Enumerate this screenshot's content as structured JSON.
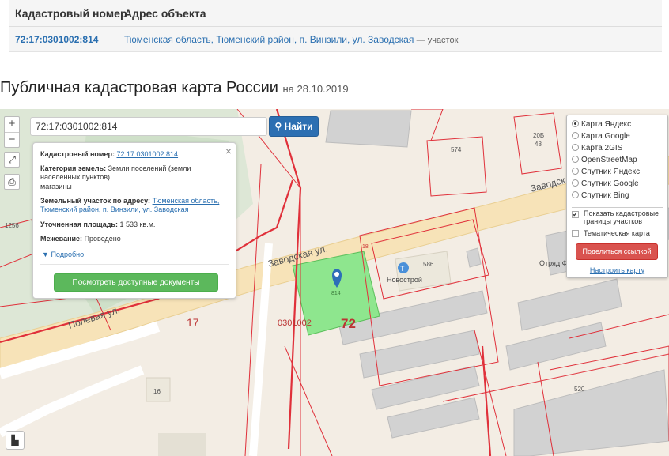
{
  "table": {
    "col_number": "Кадастровый номер",
    "col_address": "Адрес объекта",
    "row": {
      "number": "72:17:0301002:814",
      "address": "Тюменская область, Тюменский район, п. Винзили, ул. Заводская",
      "type": "— участок"
    }
  },
  "title": {
    "main": "Публичная кадастровая карта России",
    "date": "на 28.10.2019"
  },
  "search": {
    "value": "72:17:0301002:814",
    "button": "Найти"
  },
  "controls": {
    "zoom_in": "+",
    "zoom_out": "−"
  },
  "popup": {
    "cad_label": "Кадастровый номер:",
    "cad_value": "72:17:0301002:814",
    "category_label": "Категория земель:",
    "category_value": "Земли поселений (земли населенных пунктов)",
    "use_value": "магазины",
    "address_label": "Земельный участок по адресу:",
    "address_value": "Тюменская область, Тюменский район, п. Винзили, ул. Заводская",
    "area_label": "Уточненная площадь:",
    "area_value": "1 533 кв.м.",
    "survey_label": "Межевание:",
    "survey_value": "Проведено",
    "more": "Подробно",
    "docs_button": "Посмотреть доступные документы"
  },
  "layers": {
    "items": [
      {
        "label": "Карта Яндекс",
        "selected": true
      },
      {
        "label": "Карта Google",
        "selected": false
      },
      {
        "label": "Карта 2GIS",
        "selected": false
      },
      {
        "label": "OpenStreetMap",
        "selected": false
      },
      {
        "label": "Спутник Яндекс",
        "selected": false
      },
      {
        "label": "Спутник Google",
        "selected": false
      },
      {
        "label": "Спутник Bing",
        "selected": false
      }
    ],
    "show_borders": "Показать кадастровые границы участков",
    "show_borders_checked": true,
    "thematic": "Тематическая карта",
    "thematic_checked": false,
    "share": "Поделиться ссылкой",
    "configure": "Настроить карту"
  },
  "map_labels": {
    "street_zavodskaya": "Заводская ул.",
    "street_zavodskaya_2": "Заводск",
    "street_polevaya": "Полевая ул.",
    "quarter": "0301002",
    "district": "72",
    "block_17": "17",
    "parcel_814": "814",
    "parcel_18": "18",
    "house_586": "586",
    "poi_novostroy": "Новострой",
    "num_574": "574",
    "num_20b": "20Б",
    "num_48": "48",
    "num_1256": "1256",
    "num_16": "16",
    "num_520": "520",
    "poi_otryad": "Отряд Ф"
  },
  "colors": {
    "link": "#2a6fb0",
    "search_button": "#2c6fb2",
    "docs_button": "#5cb85c",
    "share_button": "#d9534f",
    "parcel_fill": "#8ee68e",
    "border_red": "#e0303a",
    "marker": "#2d6fb8"
  }
}
